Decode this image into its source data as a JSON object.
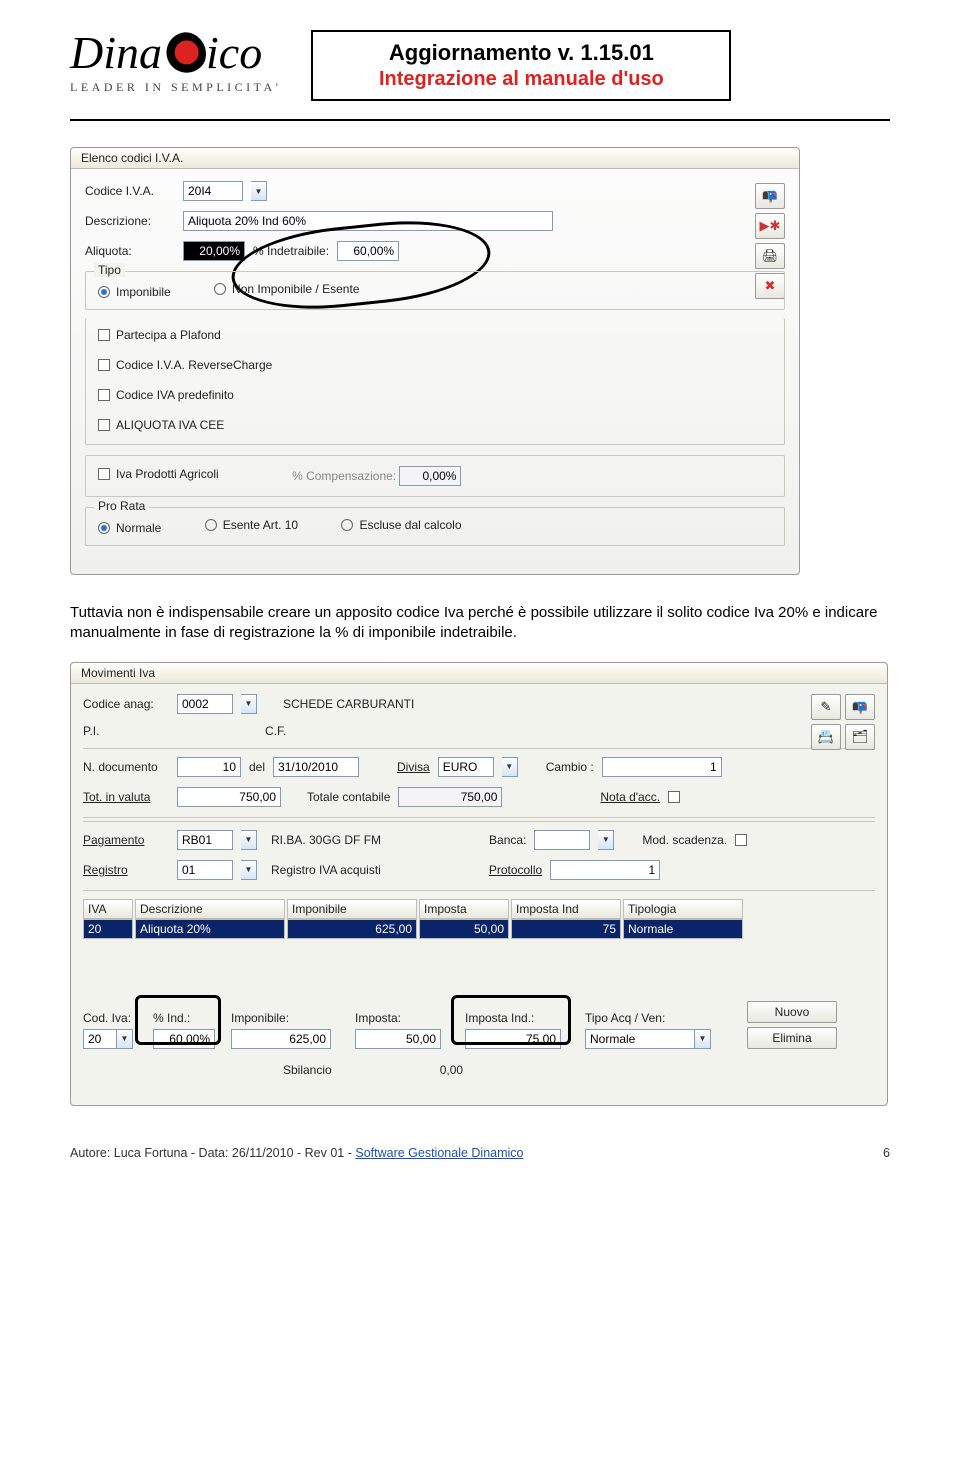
{
  "header": {
    "brand_script_left": "Dina",
    "brand_script_right": "ico",
    "tagline": "LEADER IN SEMPLICITA'",
    "title_line1": "Aggiornamento v. 1.15.01",
    "title_line2": "Integrazione al manuale d'uso"
  },
  "win1": {
    "title": "Elenco codici I.V.A.",
    "labels": {
      "codice": "Codice I.V.A.",
      "descrizione": "Descrizione:",
      "aliquota": "Aliquota:",
      "indetraibile": "% Indetraibile:",
      "tipo": "Tipo",
      "prorata": "Pro Rata",
      "compensazione": "% Compensazione:"
    },
    "values": {
      "codice": "20I4",
      "descrizione": "Aliquota 20% Ind 60%",
      "aliquota": "20,00%",
      "indetraibile": "60,00%",
      "compensazione": "0,00%"
    },
    "tipo_options": {
      "imponibile": "Imponibile",
      "non_imponibile": "Non Imponibile / Esente"
    },
    "checks": {
      "plafond": "Partecipa a Plafond",
      "reverse": "Codice I.V.A. ReverseCharge",
      "predef": "Codice IVA predefinito",
      "cee": "ALIQUOTA IVA CEE",
      "agricoli": "Iva Prodotti Agricoli"
    },
    "prorata_options": {
      "normale": "Normale",
      "esente": "Esente Art. 10",
      "escluse": "Escluse dal calcolo"
    }
  },
  "paragraph": "Tuttavia non è indispensabile creare un apposito codice Iva perché è possibile utilizzare il solito codice Iva 20% e indicare manualmente in fase di registrazione la % di imponibile indetraibile.",
  "win2": {
    "title": "Movimenti Iva",
    "labels": {
      "codice_anag": "Codice anag:",
      "pi": "P.I.",
      "cf": "C.F.",
      "ndoc": "N. documento",
      "del": "del",
      "divisa": "Divisa",
      "cambio": "Cambio :",
      "tot_valuta": "Tot. in valuta",
      "tot_contabile": "Totale contabile",
      "nota": "Nota d'acc.",
      "pagamento": "Pagamento",
      "banca": "Banca:",
      "mod_scad": "Mod. scadenza.",
      "registro": "Registro",
      "protocollo": "Protocollo"
    },
    "values": {
      "codice_anag": "0002",
      "anag_desc": "SCHEDE CARBURANTI",
      "pi": "",
      "cf": "",
      "ndoc": "10",
      "del": "31/10/2010",
      "divisa": "EURO",
      "cambio": "1",
      "tot_valuta": "750,00",
      "tot_contabile": "750,00",
      "pagamento": "RB01",
      "pagamento_desc": "RI.BA. 30GG DF FM",
      "banca": "",
      "registro": "01",
      "registro_desc": "Registro IVA acquisti",
      "protocollo": "1"
    },
    "table": {
      "headers": [
        "IVA",
        "Descrizione",
        "Imponibile",
        "Imposta",
        "Imposta Ind",
        "Tipologia"
      ],
      "row": [
        "20",
        "Aliquota 20%",
        "625,00",
        "50,00",
        "75",
        "Normale"
      ]
    },
    "detail": {
      "labels": {
        "cod_iva": "Cod. Iva:",
        "pct_ind": "% Ind.:",
        "imponibile": "Imponibile:",
        "imposta": "Imposta:",
        "imposta_ind": "Imposta Ind.:",
        "tipo_acq": "Tipo Acq / Ven:",
        "nuovo": "Nuovo",
        "elimina": "Elimina"
      },
      "values": {
        "cod_iva": "20",
        "pct_ind": "60,00%",
        "imponibile": "625,00",
        "imposta": "50,00",
        "imposta_ind": "75,00",
        "tipo_acq": "Normale"
      }
    },
    "sbilancio": {
      "label": "Sbilancio",
      "value": "0,00"
    }
  },
  "footer": {
    "text_prefix": "Autore: Luca Fortuna -  Data: 26/11/2010  - Rev 01 - ",
    "link": "Software Gestionale Dinamico",
    "page": "6"
  }
}
